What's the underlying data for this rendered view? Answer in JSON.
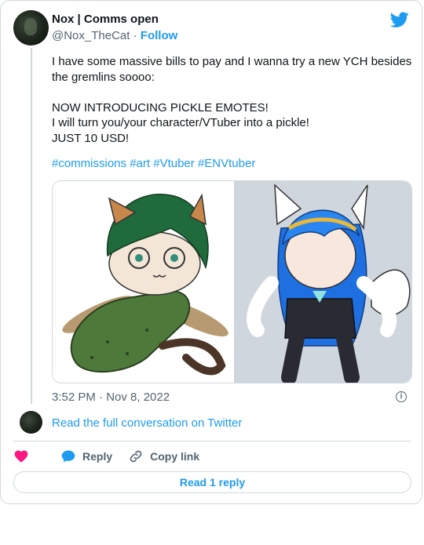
{
  "tweet": {
    "author_name": "Nox | Comms open",
    "author_handle": "@Nox_TheCat",
    "separator": "·",
    "follow_label": "Follow",
    "text": "I have some massive bills to pay and I wanna try a new YCH besides the gremlins soooo:\n\nNOW INTRODUCING PICKLE EMOTES!\nI will turn you/your character/VTuber into a pickle!\nJUST 10 USD!",
    "hashtags": [
      "#commissions",
      "#art",
      "#Vtuber",
      "#ENVtuber"
    ],
    "timestamp": "3:52 PM · Nov 8, 2022",
    "read_conversation": "Read the full conversation on Twitter",
    "actions": {
      "reply_label": "Reply",
      "copy_link_label": "Copy link"
    },
    "read_reply_label": "Read 1 reply"
  },
  "colors": {
    "accent": "#1d9bf0",
    "like": "#f91880",
    "muted": "#536471",
    "border": "#cfd9de"
  },
  "icons": {
    "brand": "twitter-bird-icon",
    "info": "info-icon",
    "like": "heart-icon",
    "reply": "speech-bubble-icon",
    "copy": "link-icon"
  }
}
